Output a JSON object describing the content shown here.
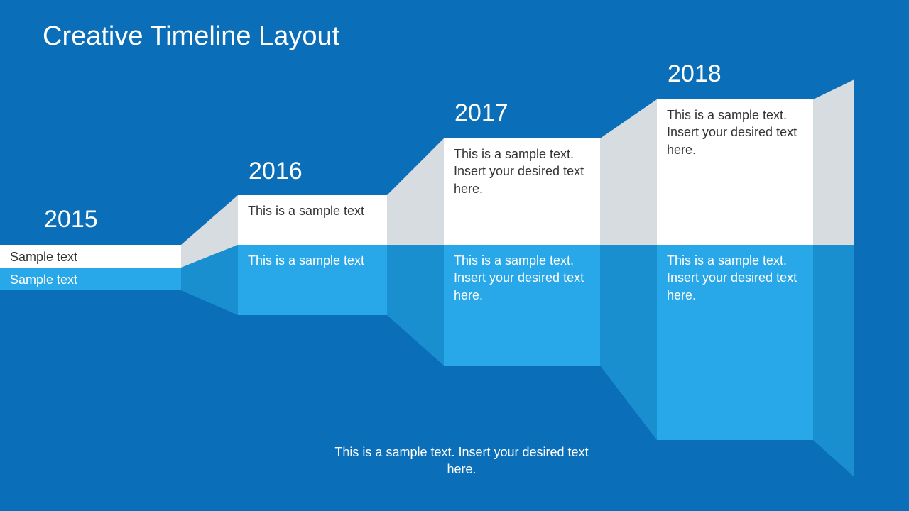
{
  "title": "Creative Timeline Layout",
  "caption": "This is a sample text. Insert your desired text here.",
  "colors": {
    "bg": "#0a6fb8",
    "lightBlue": "#28a8e8",
    "connTop": "#d7dce0",
    "connBot": "#1a8fd0"
  },
  "steps": [
    {
      "year": "2015",
      "top": "Sample text",
      "bot": "Sample text"
    },
    {
      "year": "2016",
      "top": "This is a sample text",
      "bot": "This is a sample text"
    },
    {
      "year": "2017",
      "top": "This is a sample text. Insert your desired text here.",
      "bot": "This is a sample text. Insert your desired text here."
    },
    {
      "year": "2018",
      "top": "This is a sample text. Insert your desired text here.",
      "bot": "This is a sample text. Insert your desired text here."
    }
  ]
}
